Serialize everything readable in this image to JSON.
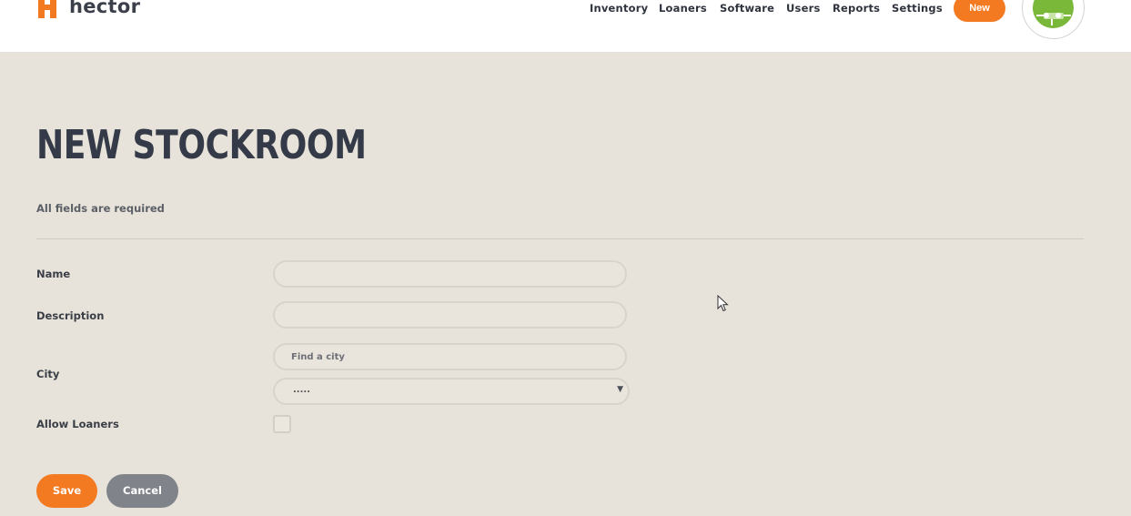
{
  "app": {
    "name": "hector"
  },
  "nav": {
    "items": [
      "Inventory",
      "Loaners",
      "Software",
      "Users",
      "Reports",
      "Settings"
    ],
    "new_label": "New"
  },
  "page": {
    "title": "NEW STOCKROOM",
    "required_note": "All fields are required"
  },
  "form": {
    "name_label": "Name",
    "name_value": "",
    "description_label": "Description",
    "description_value": "",
    "city_label": "City",
    "city_search_placeholder": "Find a city",
    "city_select_value": ".....",
    "allow_loaners_label": "Allow Loaners",
    "allow_loaners_checked": false
  },
  "actions": {
    "save_label": "Save",
    "cancel_label": "Cancel"
  },
  "colors": {
    "accent": "#f47a21",
    "background": "#e7e3da",
    "cancel": "#80848a"
  },
  "icons": {
    "logo": "hector-h-logo-icon",
    "avatar": "circuit-avatar-icon",
    "dropdown": "caret-down-icon",
    "cursor": "mouse-pointer-icon"
  }
}
